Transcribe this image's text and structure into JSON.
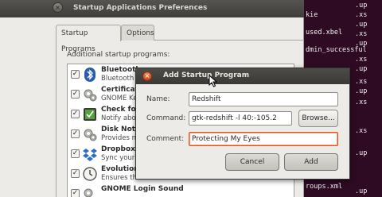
{
  "terminal": {
    "lines": [
      ".up",
      ".xs",
      "kie",
      ".up",
      "used.xbel",
      ".xs",
      ".up",
      "dmin_successful",
      ".xs",
      ".up",
      ".xs",
      ".up",
      ".xs",
      ".xs",
      ".up",
      "roups.xml",
      ".up"
    ]
  },
  "main_window": {
    "title": "Startup Applications Preferences",
    "tabs": [
      {
        "label": "Startup Programs",
        "active": true
      },
      {
        "label": "Options",
        "active": false
      }
    ],
    "list_label": "Additional startup programs:",
    "programs": [
      {
        "name": "Bluetooth",
        "desc": "Bluetooth",
        "checked": true,
        "icon": "bluetooth-icon"
      },
      {
        "name": "Certificate",
        "desc": "GNOME Ke",
        "checked": true,
        "icon": "gears-icon"
      },
      {
        "name": "Check for",
        "desc": "Notify abo",
        "checked": true,
        "icon": "update-icon"
      },
      {
        "name": "Disk Notific",
        "desc": "Provides n",
        "checked": true,
        "icon": "gears-icon"
      },
      {
        "name": "Dropbox",
        "desc": "Sync your",
        "checked": true,
        "icon": "dropbox-icon"
      },
      {
        "name": "Evolution",
        "desc": "Ensures that alarms set in Evol...",
        "checked": true,
        "icon": "clock-icon"
      },
      {
        "name": "GNOME Login Sound",
        "desc": "",
        "checked": true,
        "icon": "gears-icon"
      }
    ]
  },
  "dialog": {
    "title": "Add Startup Program",
    "name_label": "Name:",
    "name_value": "Redshift",
    "command_label": "Command:",
    "command_value": "gtk-redshift -l 40:-105.2",
    "browse_label": "Browse...",
    "comment_label": "Comment:",
    "comment_value": "Protecting My Eyes",
    "cancel_label": "Cancel",
    "add_label": "Add"
  },
  "colors": {
    "terminal_bg": "#2e0b22",
    "close_button": "#e0551d",
    "focus_border": "#e0551d"
  }
}
